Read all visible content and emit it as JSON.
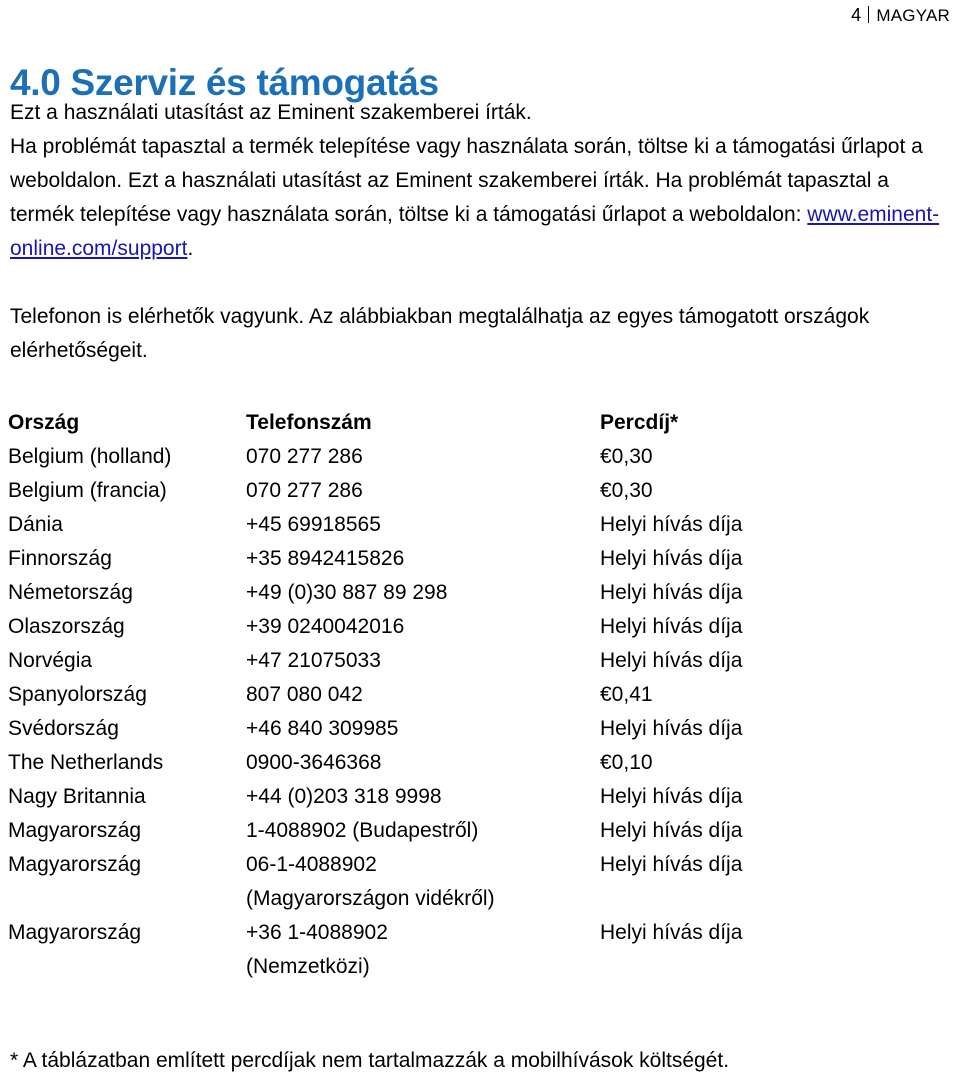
{
  "header": {
    "page_number": "4",
    "separator": "|",
    "language": "MAGYAR"
  },
  "title": "4.0 Szerviz és támogatás",
  "intro": {
    "line1": "Ezt a használati utasítást az Eminent szakemberei írták.",
    "line2": "Ha problémát tapasztal a termék telepítése vagy használata során, töltse ki a támogatási űrlapot a weboldalon. Ezt a használati utasítást az Eminent szakemberei írták. Ha problémát tapasztal a termék telepítése vagy használata során, töltse ki a támogatási űrlapot a weboldalon: ",
    "link_text": "www.eminent-online.com/support",
    "line2_end": "."
  },
  "phone_intro": "Telefonon is elérhetők vagyunk. Az alábbiakban megtalálhatja az egyes támogatott országok elérhetőségeit.",
  "table": {
    "headers": {
      "country": "Ország",
      "phone": "Telefonszám",
      "rate": "Percdíj*"
    },
    "rows": [
      {
        "country": "Belgium (holland)",
        "phone": "070 277 286",
        "phone2": "",
        "rate": "€0,30"
      },
      {
        "country": "Belgium (francia)",
        "phone": "070 277 286",
        "phone2": "",
        "rate": "€0,30"
      },
      {
        "country": "Dánia",
        "phone": "+45 69918565",
        "phone2": "",
        "rate": "Helyi hívás díja"
      },
      {
        "country": "Finnország",
        "phone": "+35 8942415826",
        "phone2": "",
        "rate": "Helyi hívás díja"
      },
      {
        "country": "Németország",
        "phone": "+49 (0)30 887 89 298",
        "phone2": "",
        "rate": "Helyi hívás díja"
      },
      {
        "country": "Olaszország",
        "phone": "+39 0240042016",
        "phone2": "",
        "rate": "Helyi hívás díja"
      },
      {
        "country": "Norvégia",
        "phone": "+47 21075033",
        "phone2": "",
        "rate": "Helyi hívás díja"
      },
      {
        "country": "Spanyolország",
        "phone": "807 080 042",
        "phone2": "",
        "rate": "€0,41"
      },
      {
        "country": "Svédország",
        "phone": "+46 840 309985",
        "phone2": "",
        "rate": "Helyi hívás díja"
      },
      {
        "country": "The Netherlands",
        "phone": "0900-3646368",
        "phone2": "",
        "rate": "€0,10"
      },
      {
        "country": "Nagy Britannia",
        "phone": "+44 (0)203 318 9998",
        "phone2": "",
        "rate": "Helyi hívás díja"
      },
      {
        "country": "Magyarország",
        "phone": "1-4088902 (Budapestről)",
        "phone2": "",
        "rate": "Helyi hívás díja"
      },
      {
        "country": "Magyarország",
        "phone": "06-1-4088902",
        "phone2": "(Magyarországon vidékről)",
        "rate": "Helyi hívás díja"
      },
      {
        "country": "Magyarország",
        "phone": "+36 1-4088902",
        "phone2": "(Nemzetközi)",
        "rate": "Helyi hívás díja"
      }
    ]
  },
  "footnote": "* A táblázatban említett percdíjak nem tartalmazzák a mobilhívások költségét.",
  "colors": {
    "title_blue": "#1c70b8",
    "link_blue": "#1616b0",
    "text_black": "#000000"
  }
}
